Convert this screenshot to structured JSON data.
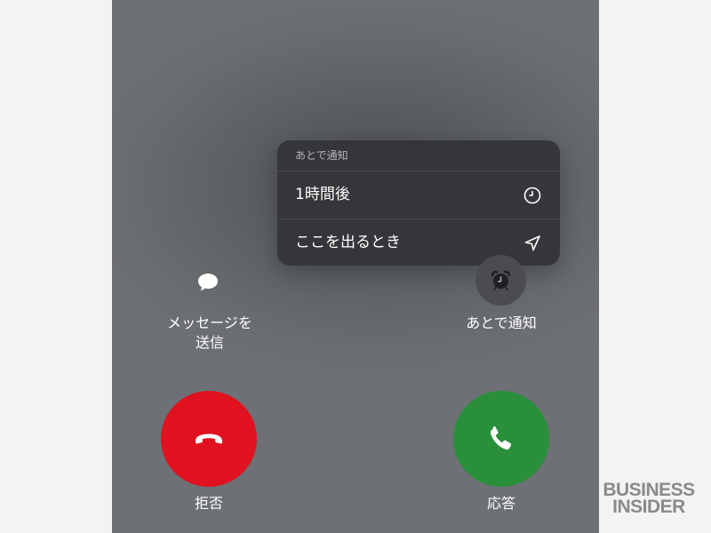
{
  "reminder_menu": {
    "header": "あとで通知",
    "items": [
      {
        "label": "1時間後",
        "icon": "clock-icon"
      },
      {
        "label": "ここを出るとき",
        "icon": "location-arrow-icon"
      }
    ]
  },
  "actions": {
    "message": {
      "label_line1": "メッセージを",
      "label_line2": "送信",
      "icon": "speech-bubble-icon"
    },
    "remind": {
      "label": "あとで通知",
      "icon": "alarm-clock-icon"
    }
  },
  "call_buttons": {
    "decline": {
      "label": "拒否",
      "icon": "phone-hangup-icon",
      "color": "#e0121f"
    },
    "accept": {
      "label": "応答",
      "icon": "phone-icon",
      "color": "#2a8f3a"
    }
  },
  "watermark": {
    "line1": "BUSINESS",
    "line2": "INSIDER"
  }
}
